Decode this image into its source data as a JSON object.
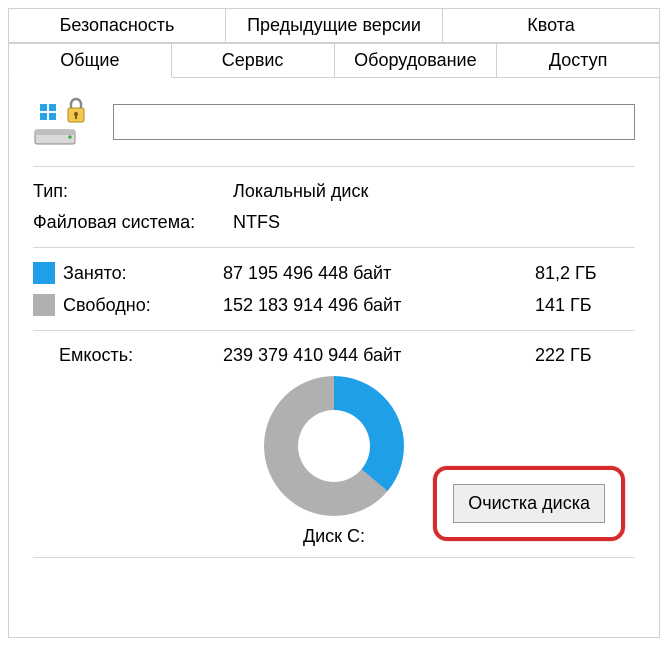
{
  "tabs": {
    "row1": [
      {
        "label": "Безопасность"
      },
      {
        "label": "Предыдущие версии"
      },
      {
        "label": "Квота"
      }
    ],
    "row2": [
      {
        "label": "Общие",
        "active": true
      },
      {
        "label": "Сервис"
      },
      {
        "label": "Оборудование"
      },
      {
        "label": "Доступ"
      }
    ]
  },
  "general": {
    "volume_label": "",
    "type_label": "Тип:",
    "type_value": "Локальный диск",
    "fs_label": "Файловая система:",
    "fs_value": "NTFS"
  },
  "usage": {
    "used_label": "Занято:",
    "used_bytes": "87 195 496 448 байт",
    "used_gb": "81,2 ГБ",
    "free_label": "Свободно:",
    "free_bytes": "152 183 914 496 байт",
    "free_gb": "141 ГБ",
    "capacity_label": "Емкость:",
    "capacity_bytes": "239 379 410 944 байт",
    "capacity_gb": "222 ГБ"
  },
  "colors": {
    "used": "#1e9fe8",
    "free": "#b0b0b0"
  },
  "drive_name": "Диск C:",
  "cleanup_button": "Очистка диска",
  "chart_data": {
    "type": "pie",
    "title": "Диск C:",
    "series": [
      {
        "name": "Занято",
        "value": 87195496448,
        "display": "81,2 ГБ",
        "color": "#1e9fe8"
      },
      {
        "name": "Свободно",
        "value": 152183914496,
        "display": "141 ГБ",
        "color": "#b0b0b0"
      }
    ],
    "total": {
      "name": "Емкость",
      "value": 239379410944,
      "display": "222 ГБ"
    }
  }
}
